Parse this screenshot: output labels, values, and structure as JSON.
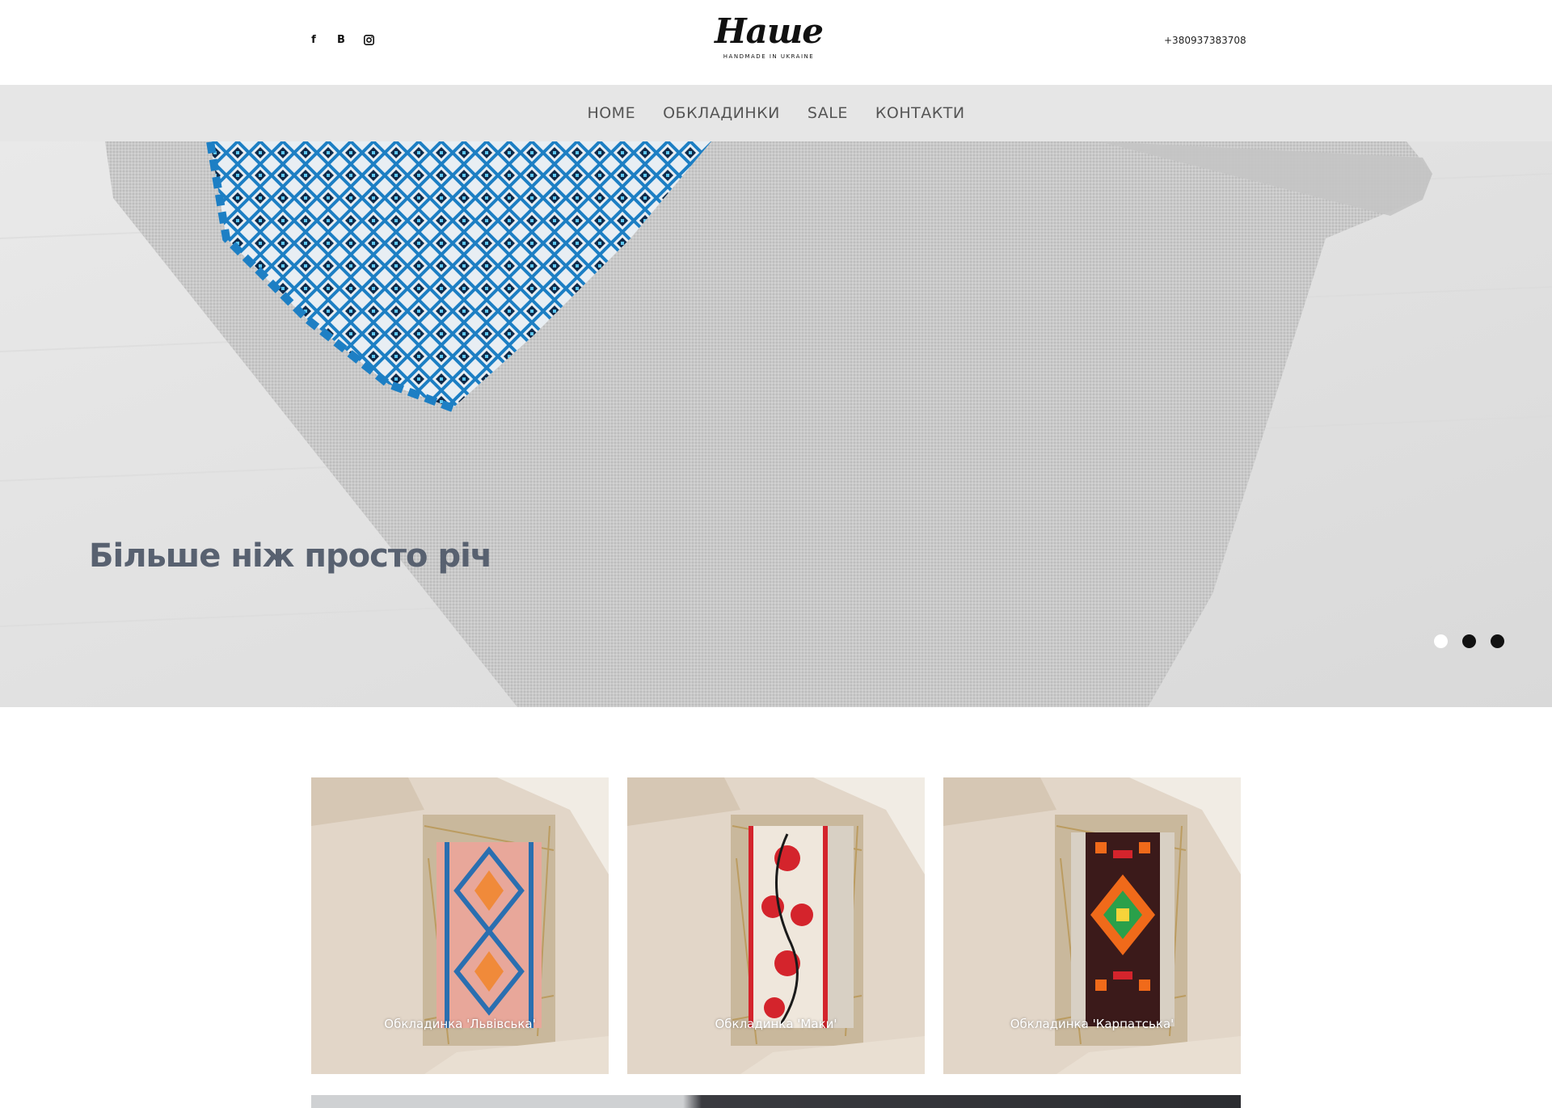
{
  "header": {
    "social": [
      {
        "icon": "facebook-icon",
        "glyph": "f"
      },
      {
        "icon": "vk-icon",
        "glyph": "B"
      },
      {
        "icon": "instagram-icon",
        "glyph": "◘"
      }
    ],
    "logo_text": "Наше",
    "logo_tagline": "HANDMADE IN UKRAINE",
    "phone": "+380937383708"
  },
  "nav": {
    "items": [
      {
        "label": "HOME"
      },
      {
        "label": "ОБКЛАДИНКИ"
      },
      {
        "label": "SALE"
      },
      {
        "label": "КОНТАКТИ"
      }
    ]
  },
  "hero": {
    "caption": "Більше ніж просто річ",
    "slides_count": 3,
    "active_slide": 1
  },
  "products": [
    {
      "title": "Обкладинка 'Львівська'",
      "pattern": "lviv",
      "colors": [
        "#e8a79a",
        "#2a6fb0",
        "#f08a3a"
      ]
    },
    {
      "title": "Обкладинка 'Маки'",
      "pattern": "poppies",
      "colors": [
        "#efe7dc",
        "#d4242c",
        "#1a1a1a"
      ]
    },
    {
      "title": "Обкладинка 'Карпатська'",
      "pattern": "carpathian",
      "colors": [
        "#3b1a1a",
        "#f06a1a",
        "#2aa04a"
      ]
    }
  ],
  "colors": {
    "nav_bg": "#e6e6e6",
    "caption": "#586170"
  }
}
